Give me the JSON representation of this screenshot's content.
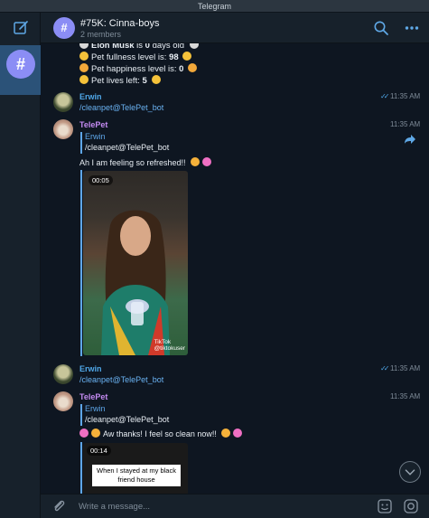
{
  "app": {
    "title": "Telegram"
  },
  "header": {
    "avatar_glyph": "#",
    "title": "#75K: Cinna-boys",
    "subtitle": "2 members"
  },
  "sidebar": {
    "chat_glyph": "#"
  },
  "pet_status": {
    "line1_pre": "Elon Musk",
    "line1_mid": " is ",
    "line1_val": "0",
    "line1_post": " days old",
    "line2_pre": "Pet fullness level is: ",
    "line2_val": "98",
    "line3_pre": "Pet happiness level is: ",
    "line3_val": "0",
    "line4_pre": "Pet lives left: ",
    "line4_val": "5"
  },
  "messages": [
    {
      "sender": "Erwin",
      "text": "/cleanpet@TelePet_bot",
      "time": "11:35 AM",
      "checks": "✓✓"
    },
    {
      "sender": "TelePet",
      "time": "11:35 AM",
      "reply_name": "Erwin",
      "reply_text": "/cleanpet@TelePet_bot",
      "text": "Ah I am feeling so refreshed!!",
      "video_duration": "00:05",
      "watermark": "TikTok",
      "watermark_sub": "@tiktokuser"
    },
    {
      "sender": "Erwin",
      "text": "/cleanpet@TelePet_bot",
      "time": "11:35 AM",
      "checks": "✓✓"
    },
    {
      "sender": "TelePet",
      "time": "11:35 AM",
      "reply_name": "Erwin",
      "reply_text": "/cleanpet@TelePet_bot",
      "text": "Aw thanks! I feel so clean now!!",
      "video_duration": "00:14",
      "video_caption": "When I stayed at my black friend house"
    }
  ],
  "composer": {
    "placeholder": "Write a message..."
  },
  "colors": {
    "accent": "#4fa7e8",
    "selected": "#2b5278",
    "bot_name": "#c48bf2",
    "background": "#0e1621"
  }
}
